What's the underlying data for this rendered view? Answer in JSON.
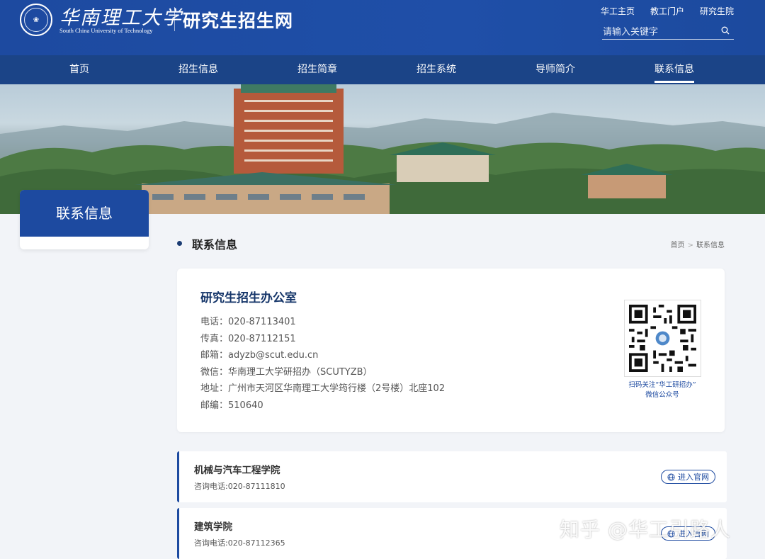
{
  "header": {
    "logo_cn": "华南理工大学",
    "logo_en": "South China University of Technology",
    "site_title": "研究生招生网",
    "top_links": [
      "华工主页",
      "教工门户",
      "研究生院"
    ],
    "search_placeholder": "请输入关键字"
  },
  "nav": {
    "items": [
      "首页",
      "招生信息",
      "招生简章",
      "招生系统",
      "导师简介",
      "联系信息"
    ],
    "active": "联系信息"
  },
  "sidebar": {
    "title": "联系信息"
  },
  "section": {
    "title": "联系信息",
    "breadcrumb": [
      "首页",
      "联系信息"
    ],
    "breadcrumb_sep": ">"
  },
  "contact": {
    "title": "研究生招生办公室",
    "lines": [
      "电话：020-87113401",
      "传真：020-87112151",
      "邮箱：adyzb@scut.edu.cn",
      "微信：华南理工大学研招办（SCUTYZB）",
      "地址：广州市天河区华南理工大学筠行楼（2号楼）北座102",
      "邮编：510640"
    ],
    "qr_caption_1": "扫码关注“华工研招办”",
    "qr_caption_2": "微信公众号"
  },
  "colleges": [
    {
      "name": "机械与汽车工程学院",
      "phone": "咨询电话:020-87111810",
      "button": "进入官网"
    },
    {
      "name": "建筑学院",
      "phone": "咨询电话:020-87112365",
      "button": "进入官网"
    }
  ],
  "watermark": "知乎 @华工引路人",
  "colors": {
    "primary": "#1d4aa0",
    "nav_bg": "#1b4487",
    "page_bg": "#f2f4f8"
  }
}
